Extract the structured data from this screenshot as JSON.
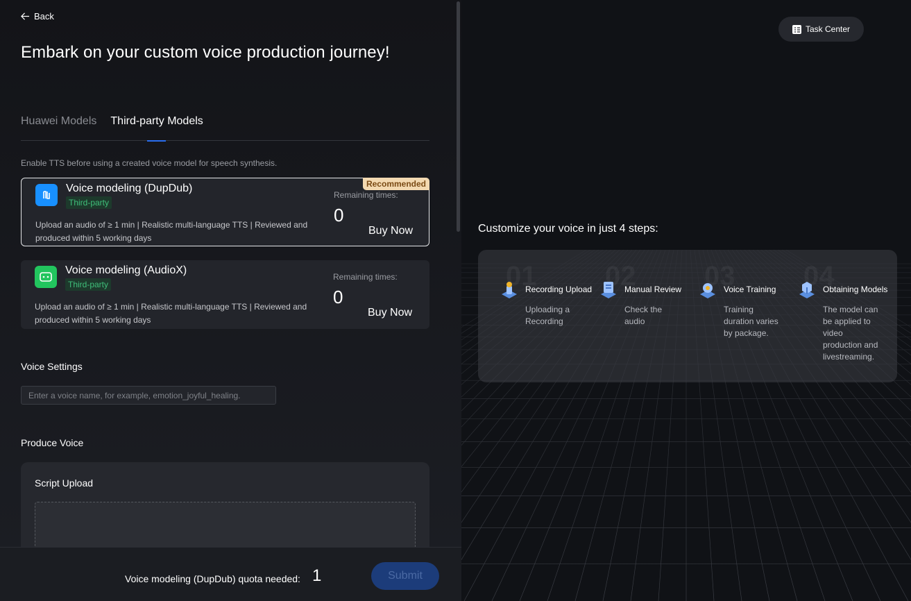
{
  "left": {
    "back_label": "Back",
    "title": "Embark on your custom voice production journey!",
    "tabs": [
      {
        "label": "Huawei Models"
      },
      {
        "label": "Third-party Models"
      }
    ],
    "hint": "Enable TTS before using a created voice model for speech synthesis.",
    "cards": [
      {
        "name": "Voice modeling (DupDub)",
        "tag": "Third-party",
        "description": "Upload an audio of ≥ 1 min | Realistic multi-language TTS | Reviewed and produced within 5 working days",
        "remaining_label": "Remaining times:",
        "remaining_value": "0",
        "buy_label": "Buy Now",
        "badge": "Recommended",
        "accent": "#1890ff"
      },
      {
        "name": "Voice modeling (AudioX)",
        "tag": "Third-party",
        "description": "Upload an audio of ≥ 1 min | Realistic multi-language TTS | Reviewed and produced within 5 working days",
        "remaining_label": "Remaining times:",
        "remaining_value": "0",
        "buy_label": "Buy Now",
        "accent": "#22c55e"
      }
    ],
    "voice_settings": {
      "heading": "Voice Settings",
      "placeholder": "Enter a voice name, for example, emotion_joyful_healing."
    },
    "produce_voice": {
      "heading": "Produce Voice",
      "script_upload_label": "Script Upload"
    },
    "footer": {
      "quota_label": "Voice modeling (DupDub) quota needed:",
      "quota_value": "1",
      "submit_label": "Submit"
    }
  },
  "right": {
    "task_center_label": "Task Center",
    "steps_title": "Customize your voice in just 4 steps:",
    "steps": [
      {
        "num": "01",
        "name": "Recording Upload",
        "desc": "Uploading a Recording",
        "icon": "upload-icon"
      },
      {
        "num": "02",
        "name": "Manual Review",
        "desc": "Check the audio",
        "icon": "review-icon"
      },
      {
        "num": "03",
        "name": "Voice Training",
        "desc": "Training duration varies by package.",
        "icon": "training-icon"
      },
      {
        "num": "04",
        "name": "Obtaining Models",
        "desc": "The model can be applied to video production and livestreaming.",
        "icon": "model-icon"
      }
    ]
  }
}
